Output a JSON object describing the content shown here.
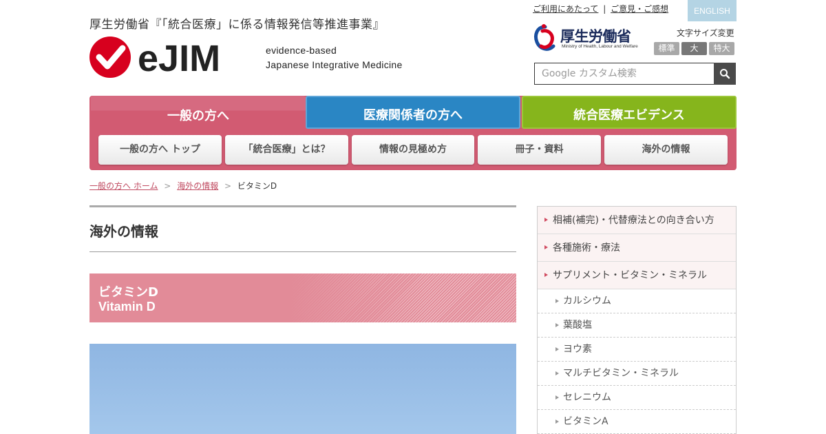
{
  "header": {
    "subtitle": "厚生労働省『「統合医療」に係る情報発信等推進事業』",
    "logo_text": "eJIM",
    "tagline_line1": "evidence-based",
    "tagline_line2": "Japanese Integrative Medicine",
    "util_links": [
      "ご利用にあたって",
      "ご意見・ご感想"
    ],
    "util_separator": "|",
    "english_label": "ENGLISH",
    "ministry_name": "厚生労働省",
    "ministry_name_en": "Ministry of Health, Labour and Welfare",
    "font_size_label": "文字サイズ変更",
    "font_sizes": [
      "標準",
      "大",
      "特大"
    ],
    "search_placeholder": "Google カスタム検索"
  },
  "nav": {
    "top_tabs": [
      "一般の方へ",
      "医療関係者の方へ",
      "統合医療エビデンス"
    ],
    "sub_items": [
      "一般の方へ トップ",
      "「統合医療」とは？",
      "情報の見極め方",
      "冊子・資料",
      "海外の情報"
    ]
  },
  "breadcrumb": {
    "items": [
      "一般の方へ ホーム",
      "海外の情報"
    ],
    "separator": ">",
    "current": "ビタミンD"
  },
  "main": {
    "section_title": "海外の情報",
    "banner_ja": "ビタミンD",
    "banner_en": "Vitamin D"
  },
  "sidebar": {
    "items": [
      "相補(補完)・代替療法との向き合い方",
      "各種施術・療法",
      "サプリメント・ビタミン・ミネラル"
    ],
    "sub_items": [
      "カルシウム",
      "葉酸塩",
      "ヨウ素",
      "マルチビタミン・ミネラル",
      "セレニウム",
      "ビタミンA"
    ]
  },
  "colors": {
    "accent_pink": "#d25b72",
    "medical_blue": "#2a86c4",
    "evidence_green": "#86b51c",
    "logo_red": "#d7001e"
  }
}
